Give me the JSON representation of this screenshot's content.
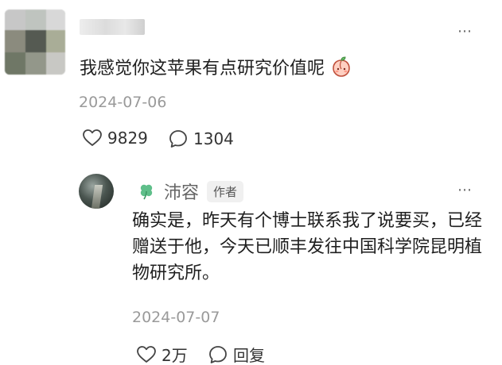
{
  "comment": {
    "user_name": "",
    "text": "我感觉你这苹果有点研究价值呢",
    "emoji": "peach-emoji",
    "date": "2024-07-06",
    "likes": "9829",
    "replies": "1304"
  },
  "reply": {
    "user_name": "沛容",
    "badge": "作者",
    "text": "确实是，昨天有个博士联系我了说要买，已经赠送于他，今天已顺丰发往中国科学院昆明植物研究所。",
    "date": "2024-07-07",
    "likes": "2万",
    "reply_label": "回复"
  },
  "icons": {
    "more": "more-icon",
    "like": "heart-outline-icon",
    "comment": "comment-bubble-icon",
    "clover": "clover-icon"
  },
  "colors": {
    "text": "#1f1f1f",
    "muted": "#9a9a9a",
    "name": "#666666",
    "clover": "#5fbf8a",
    "badge_bg": "#f0f0f0"
  }
}
